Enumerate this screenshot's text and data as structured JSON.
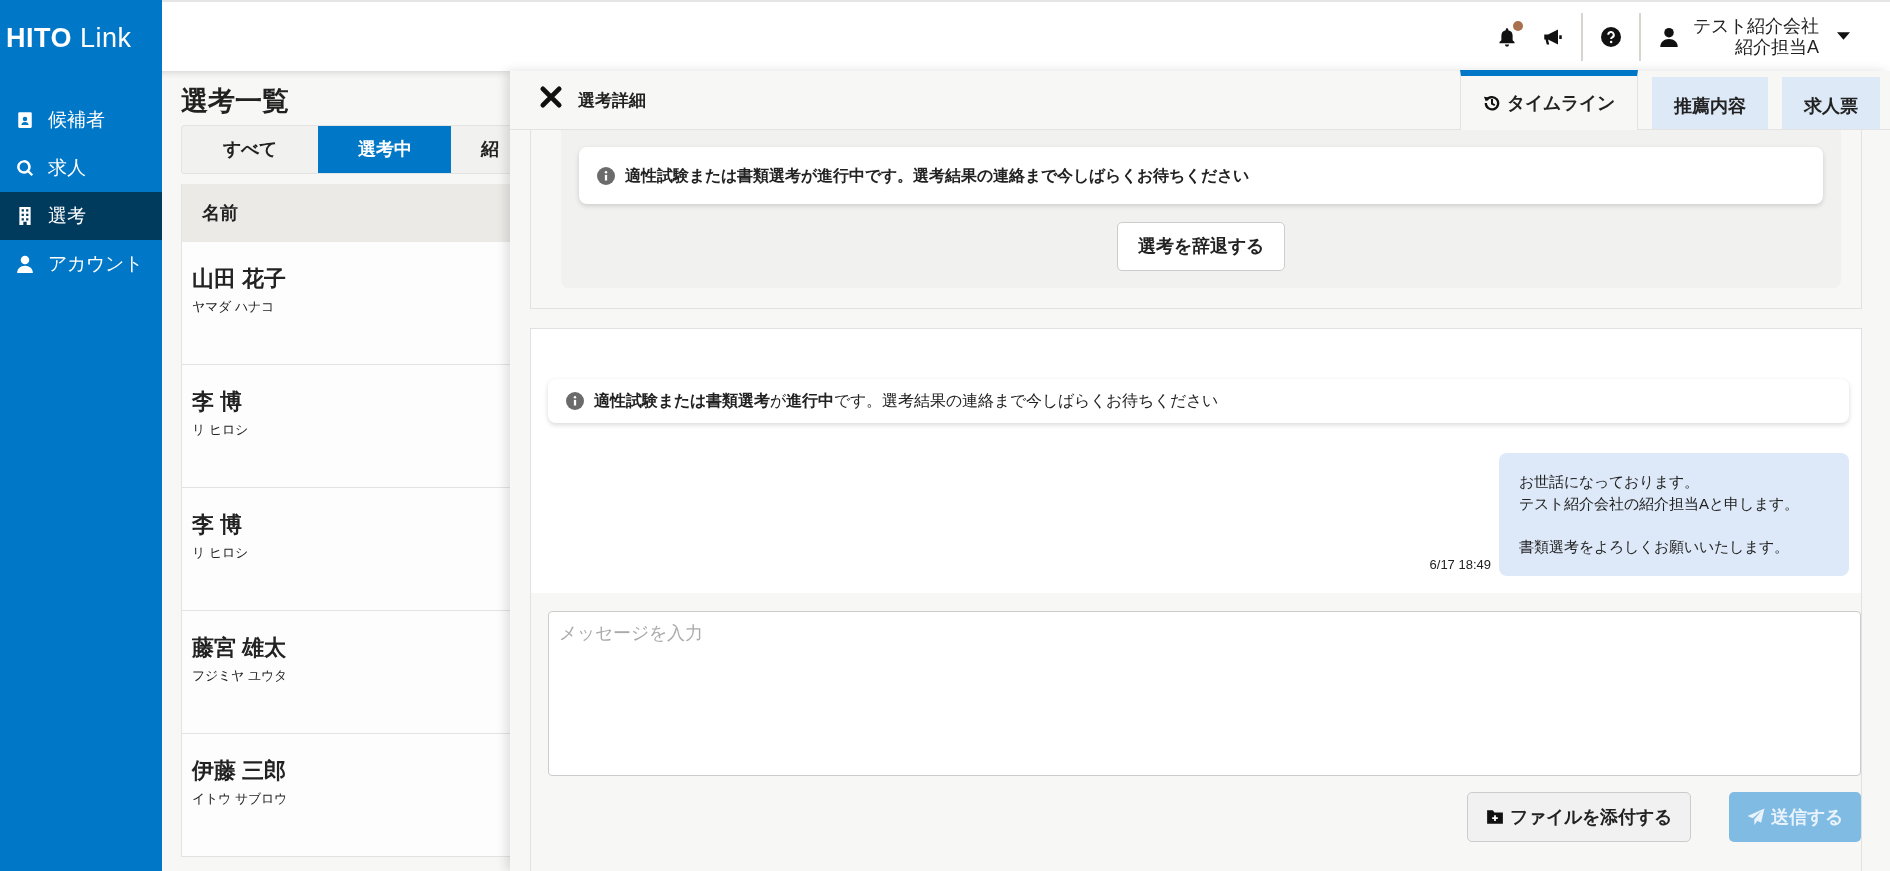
{
  "logo": "**HITO** Link",
  "sidebar": {
    "items": [
      {
        "label": "候補者",
        "selected": false
      },
      {
        "label": "求人",
        "selected": false
      },
      {
        "label": "選考",
        "selected": true
      },
      {
        "label": "アカウント",
        "selected": false
      }
    ]
  },
  "header": {
    "notifications": {
      "unread": true
    },
    "user": {
      "company": "テスト紹介会社",
      "name": "紹介担当A"
    }
  },
  "list_panel": {
    "title": "選考一覧",
    "tabs": [
      {
        "label": "すべて",
        "selected": false
      },
      {
        "label": "選考中",
        "selected": true
      },
      {
        "label": "紹",
        "selected": false
      }
    ],
    "table": {
      "columns": [
        "名前"
      ],
      "rows": [
        {
          "name": "山田 花子",
          "kana": "ヤマダ ハナコ"
        },
        {
          "name": "李 博",
          "kana": "リ ヒロシ"
        },
        {
          "name": "李 博",
          "kana": "リ ヒロシ"
        },
        {
          "name": "藤宮 雄太",
          "kana": "フジミヤ ユウタ"
        },
        {
          "name": "伊藤 三郎",
          "kana": "イトウ サブロウ"
        }
      ]
    }
  },
  "detail": {
    "title": "選考詳細",
    "tabs": [
      {
        "label": "タイムライン",
        "selected": true
      },
      {
        "label": "推薦内容",
        "selected": false
      },
      {
        "label": "求人票",
        "selected": false
      }
    ],
    "status_card": {
      "notice": "適性試験または書類選考が進行中です。選考結果の連絡まで今しばらくお待ちください",
      "button": "選考を辞退する"
    },
    "timeline": {
      "notice": "**適性試験または書類選考**が**進行中**です。選考結果の連絡まで今しばらくお待ちください",
      "messages": [
        {
          "paragraphs": [
            {
              "lines": [
                "お世話になっております。",
                "テスト紹介会社の紹介担当Aと申します。"
              ]
            },
            {
              "lines": [
                "書類選考をよろしくお願いいたします。"
              ]
            }
          ],
          "time": "6/17 18:49"
        }
      ]
    },
    "composer": {
      "placeholder": "メッセージを入力",
      "attach_button": "ファイルを添付する",
      "send_button": {
        "label": "送信する",
        "disabled": true
      }
    }
  }
}
